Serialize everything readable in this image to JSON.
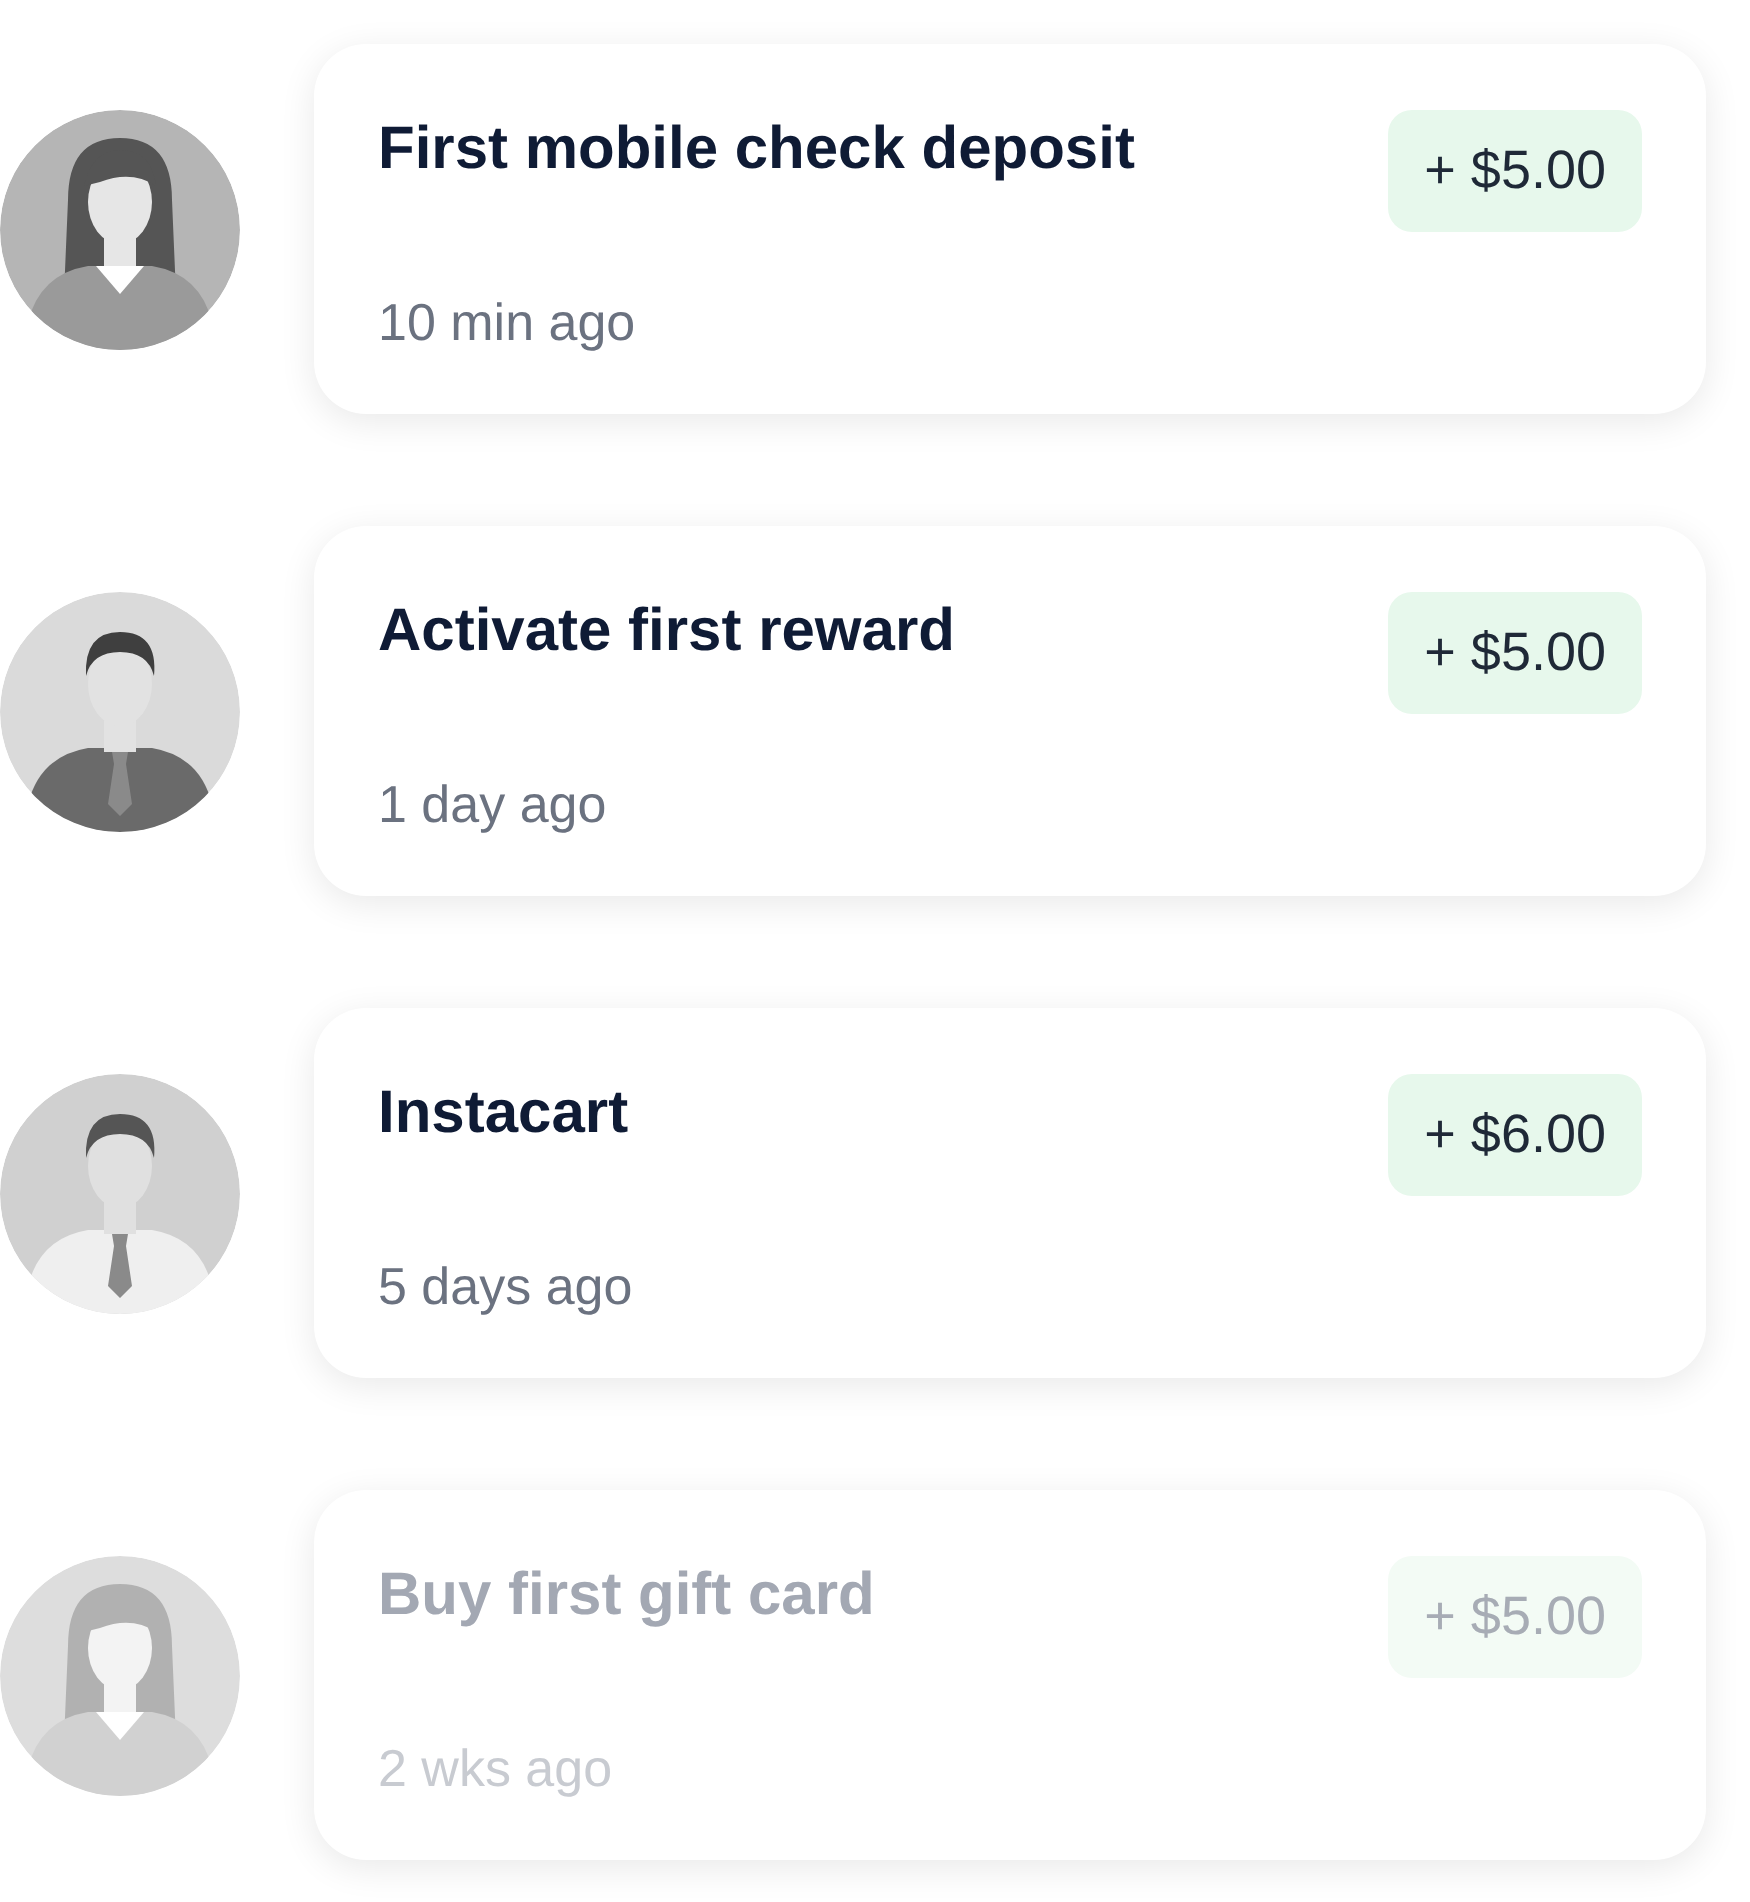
{
  "activities": [
    {
      "title": "First mobile check deposit",
      "time": "10 min ago",
      "amount": "+ $5.00",
      "kind": "woman",
      "faded": false
    },
    {
      "title": "Activate first reward",
      "time": "1 day ago",
      "amount": "+ $5.00",
      "kind": "suit",
      "faded": false
    },
    {
      "title": "Instacart",
      "time": "5 days ago",
      "amount": "+ $6.00",
      "kind": "man",
      "faded": false
    },
    {
      "title": "Buy first gift card",
      "time": "2 wks ago",
      "amount": "+ $5.00",
      "kind": "woman",
      "faded": true
    }
  ]
}
